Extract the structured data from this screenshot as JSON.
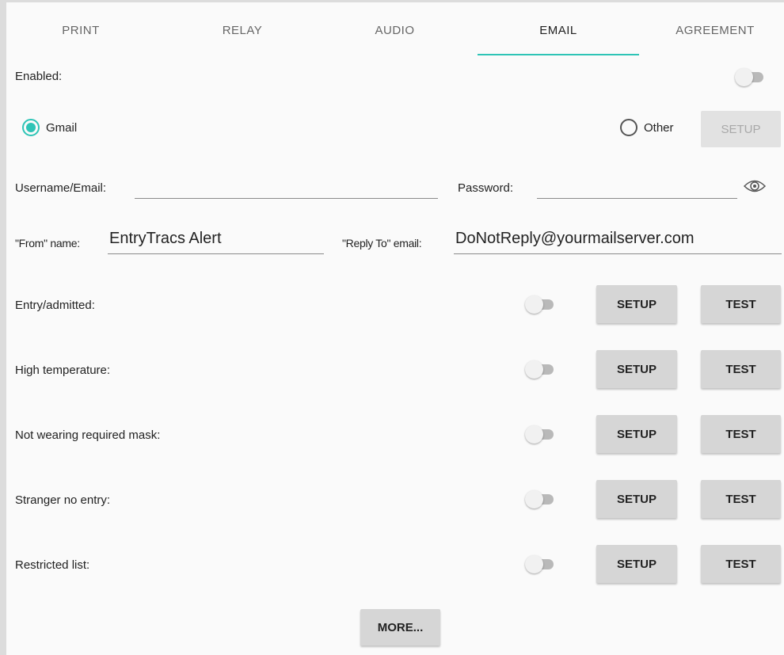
{
  "tabs": [
    {
      "label": "PRINT",
      "active": false
    },
    {
      "label": "RELAY",
      "active": false
    },
    {
      "label": "AUDIO",
      "active": false
    },
    {
      "label": "EMAIL",
      "active": true
    },
    {
      "label": "AGREEMENT",
      "active": false
    }
  ],
  "colors": {
    "accent": "#2ec4b6",
    "button_bg": "#d6d6d6",
    "switch_off": "#b9b9b9"
  },
  "enabled": {
    "label": "Enabled:",
    "on": false
  },
  "provider": {
    "gmail_label": "Gmail",
    "gmail_selected": true,
    "other_label": "Other",
    "other_selected": false,
    "setup_label": "SETUP",
    "setup_enabled": false
  },
  "credentials": {
    "username_label": "Username/Email:",
    "username_value": "",
    "password_label": "Password:",
    "password_value": "",
    "reveal_icon": "eye-icon"
  },
  "sender": {
    "from_label": "\"From\" name:",
    "from_value": "EntryTracs Alert",
    "reply_label": "\"Reply To\" email:",
    "reply_value": "DoNotReply@yourmailserver.com"
  },
  "alerts": [
    {
      "label": "Entry/admitted:",
      "on": false,
      "setup_label": "SETUP",
      "test_label": "TEST"
    },
    {
      "label": "High temperature:",
      "on": false,
      "setup_label": "SETUP",
      "test_label": "TEST"
    },
    {
      "label": "Not wearing required mask:",
      "on": false,
      "setup_label": "SETUP",
      "test_label": "TEST"
    },
    {
      "label": "Stranger no entry:",
      "on": false,
      "setup_label": "SETUP",
      "test_label": "TEST"
    },
    {
      "label": "Restricted list:",
      "on": false,
      "setup_label": "SETUP",
      "test_label": "TEST"
    }
  ],
  "more_label": "MORE..."
}
